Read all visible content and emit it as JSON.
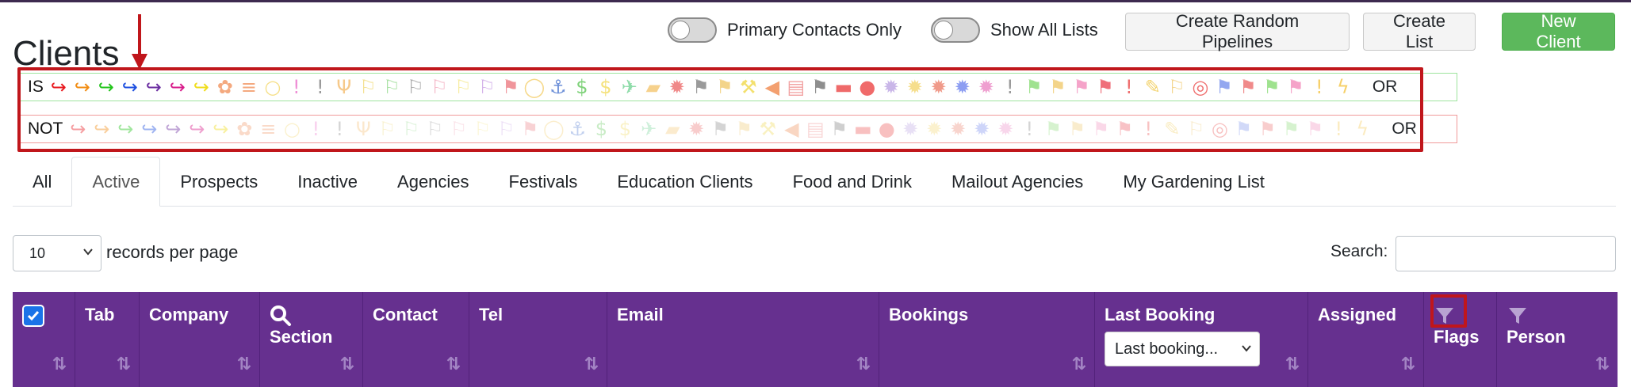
{
  "page": {
    "title": "Clients"
  },
  "toggles": [
    {
      "label": "Primary Contacts Only",
      "on": false
    },
    {
      "label": "Show All Lists",
      "on": false
    }
  ],
  "buttons": {
    "random_pipelines": "Create Random Pipelines",
    "create_list": "Create List",
    "new_client": "New Client"
  },
  "flag_filter": {
    "is_label": "IS",
    "not_label": "NOT",
    "or_label": "OR",
    "icons": [
      {
        "name": "share-arrow-red-icon",
        "glyph": "↪",
        "color": "#e8191e"
      },
      {
        "name": "share-arrow-orange-icon",
        "glyph": "↪",
        "color": "#f28c12"
      },
      {
        "name": "share-arrow-green-icon",
        "glyph": "↪",
        "color": "#22c41b"
      },
      {
        "name": "share-arrow-blue-icon",
        "glyph": "↪",
        "color": "#1d4fe0"
      },
      {
        "name": "share-arrow-purple-icon",
        "glyph": "↪",
        "color": "#6a2ca0"
      },
      {
        "name": "share-arrow-magenta-icon",
        "glyph": "↪",
        "color": "#d81b8a"
      },
      {
        "name": "share-arrow-yellow-icon",
        "glyph": "↪",
        "color": "#f0dd1c"
      },
      {
        "name": "users-icon",
        "glyph": "✿",
        "color": "#f4a97f"
      },
      {
        "name": "database-icon",
        "glyph": "≡",
        "color": "#f4a97f"
      },
      {
        "name": "lightbulb-icon",
        "glyph": "○",
        "color": "#f6e08a"
      },
      {
        "name": "exclamation-pink-icon",
        "glyph": "!",
        "color": "#ef8fd6"
      },
      {
        "name": "exclamation-gray-icon",
        "glyph": "!",
        "color": "#9a9a9a"
      },
      {
        "name": "cutlery-icon",
        "glyph": "Ψ",
        "color": "#f6c98a"
      },
      {
        "name": "flag-yellow-icon",
        "glyph": "⚐",
        "color": "#f3e08e"
      },
      {
        "name": "flag-green-icon",
        "glyph": "⚐",
        "color": "#a8e1a2"
      },
      {
        "name": "flag-gray-icon",
        "glyph": "⚐",
        "color": "#a8a8a8"
      },
      {
        "name": "flag-pink-icon",
        "glyph": "⚐",
        "color": "#f5b8c8"
      },
      {
        "name": "flag-lightyellow-icon",
        "glyph": "⚐",
        "color": "#f7ec9c"
      },
      {
        "name": "flag-lilac-icon",
        "glyph": "⚐",
        "color": "#d3b0ea"
      },
      {
        "name": "flag-red-icon",
        "glyph": "⚑",
        "color": "#f0959b"
      },
      {
        "name": "comment-icon",
        "glyph": "◯",
        "color": "#f6d889"
      },
      {
        "name": "anchor-icon",
        "glyph": "⚓",
        "color": "#6c8fd8"
      },
      {
        "name": "dollar-green-icon",
        "glyph": "$",
        "color": "#7fd27a"
      },
      {
        "name": "dollar-yellow-icon",
        "glyph": "$",
        "color": "#f5e27d"
      },
      {
        "name": "plane-icon",
        "glyph": "✈",
        "color": "#8fdcaa"
      },
      {
        "name": "folder-icon",
        "glyph": "▰",
        "color": "#f6d18c"
      },
      {
        "name": "gear-pink-icon",
        "glyph": "✹",
        "color": "#f08888"
      },
      {
        "name": "flag-darkgray-icon",
        "glyph": "⚑",
        "color": "#9a9a9a"
      },
      {
        "name": "flag-sand-icon",
        "glyph": "⚑",
        "color": "#f3d48a"
      },
      {
        "name": "hammer-icon",
        "glyph": "⚒",
        "color": "#f3e06e"
      },
      {
        "name": "megaphone-icon",
        "glyph": "◀",
        "color": "#f3a070"
      },
      {
        "name": "document-icon",
        "glyph": "▤",
        "color": "#f2a2a2"
      },
      {
        "name": "flag-gray2-icon",
        "glyph": "⚑",
        "color": "#8e8e8e"
      },
      {
        "name": "car-icon",
        "glyph": "▬",
        "color": "#ef6a6a"
      },
      {
        "name": "apple-icon",
        "glyph": "●",
        "color": "#f06a6a"
      },
      {
        "name": "gear-lilac-icon",
        "glyph": "✹",
        "color": "#c9b6e8"
      },
      {
        "name": "gear-yellow-icon",
        "glyph": "✹",
        "color": "#f6de8c"
      },
      {
        "name": "gear-salmon-icon",
        "glyph": "✹",
        "color": "#f09a8a"
      },
      {
        "name": "gear-blue-icon",
        "glyph": "✹",
        "color": "#8c9df2"
      },
      {
        "name": "gear-pink2-icon",
        "glyph": "✹",
        "color": "#ef9fd0"
      },
      {
        "name": "exclamation-gray2-icon",
        "glyph": "!",
        "color": "#9a9a9a"
      },
      {
        "name": "flag-lightgreen-icon",
        "glyph": "⚑",
        "color": "#9fe28f"
      },
      {
        "name": "flag-sand2-icon",
        "glyph": "⚑",
        "color": "#f3d48a"
      },
      {
        "name": "flag-pink2-icon",
        "glyph": "⚑",
        "color": "#f5a3c9"
      },
      {
        "name": "flag-red2-icon",
        "glyph": "⚑",
        "color": "#ef6f7a"
      },
      {
        "name": "exclamation-red-icon",
        "glyph": "!",
        "color": "#ef6f6f"
      },
      {
        "name": "pencil-icon",
        "glyph": "✎",
        "color": "#f3d36e"
      },
      {
        "name": "flag-checkered-icon",
        "glyph": "⚐",
        "color": "#f3d48a"
      },
      {
        "name": "life-ring-icon",
        "glyph": "◎",
        "color": "#ef6f6f"
      },
      {
        "name": "flag-blue-icon",
        "glyph": "⚑",
        "color": "#93a7f0"
      },
      {
        "name": "flag-coral-icon",
        "glyph": "⚑",
        "color": "#f08a8a"
      },
      {
        "name": "flag-green2-icon",
        "glyph": "⚑",
        "color": "#9fe28f"
      },
      {
        "name": "flag-pink3-icon",
        "glyph": "⚑",
        "color": "#f5a3c9"
      },
      {
        "name": "exclamation-yellow-icon",
        "glyph": "!",
        "color": "#f6d06a"
      },
      {
        "name": "bolt-icon",
        "glyph": "ϟ",
        "color": "#f6d06a"
      }
    ]
  },
  "tabs": [
    {
      "label": "All",
      "active": false
    },
    {
      "label": "Active",
      "active": true
    },
    {
      "label": "Prospects",
      "active": false
    },
    {
      "label": "Inactive",
      "active": false
    },
    {
      "label": "Agencies",
      "active": false
    },
    {
      "label": "Festivals",
      "active": false
    },
    {
      "label": "Education Clients",
      "active": false
    },
    {
      "label": "Food and Drink",
      "active": false
    },
    {
      "label": "Mailout Agencies",
      "active": false
    },
    {
      "label": "My Gardening List",
      "active": false
    }
  ],
  "records": {
    "value": "10",
    "label": "records per page"
  },
  "search": {
    "label": "Search:",
    "value": ""
  },
  "table": {
    "columns": [
      {
        "key": "tab",
        "label": "Tab"
      },
      {
        "key": "company",
        "label": "Company"
      },
      {
        "key": "section",
        "label": "Section"
      },
      {
        "key": "contact",
        "label": "Contact"
      },
      {
        "key": "tel",
        "label": "Tel"
      },
      {
        "key": "email",
        "label": "Email"
      },
      {
        "key": "bookings",
        "label": "Bookings"
      },
      {
        "key": "last_booking",
        "label": "Last Booking",
        "filter_value": "Last booking..."
      },
      {
        "key": "assigned",
        "label": "Assigned"
      },
      {
        "key": "flags",
        "label": "Flags"
      },
      {
        "key": "person",
        "label": "Person"
      }
    ],
    "header_bg": "#66308f"
  },
  "colors": {
    "accent_red": "#c0161b",
    "success": "#5cb85c"
  }
}
